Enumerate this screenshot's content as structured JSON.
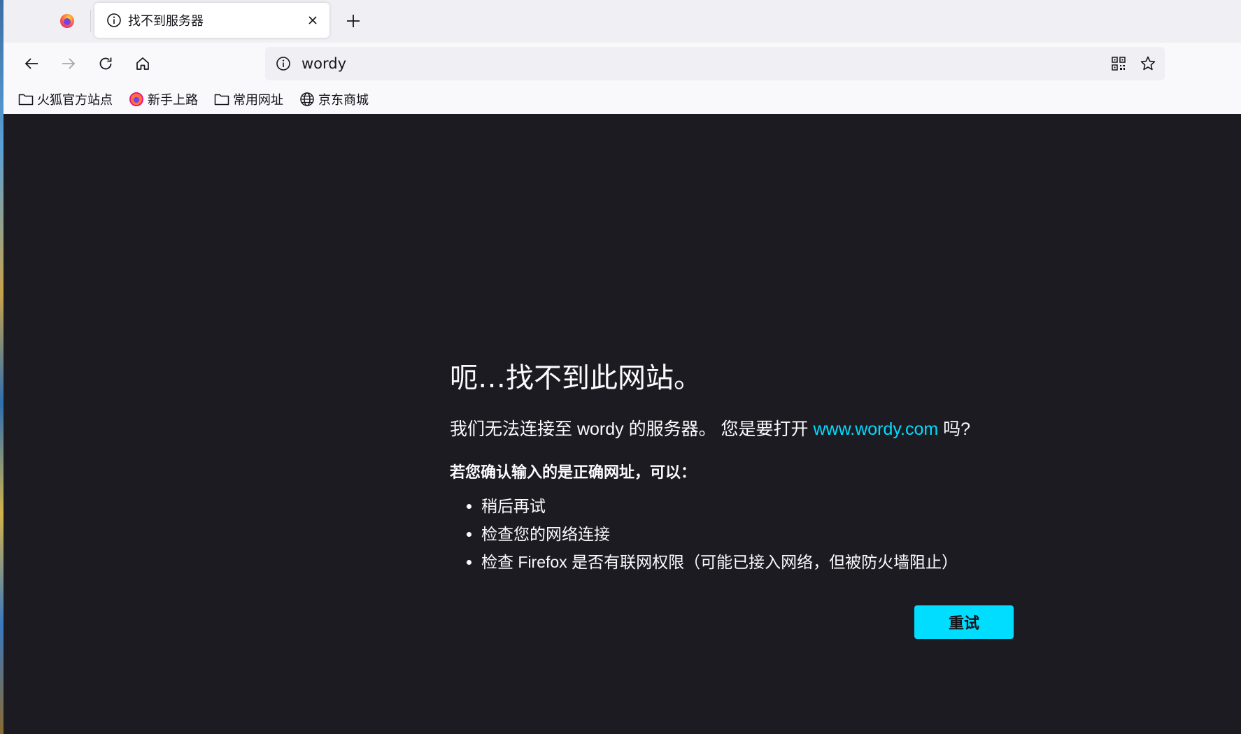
{
  "tabs": {
    "active_title": "找不到服务器"
  },
  "urlbar": {
    "value": "wordy"
  },
  "bookmarks": [
    {
      "label": "火狐官方站点",
      "icon": "folder-icon"
    },
    {
      "label": "新手上路",
      "icon": "firefox-icon"
    },
    {
      "label": "常用网址",
      "icon": "folder-icon"
    },
    {
      "label": "京东商城",
      "icon": "globe-icon"
    }
  ],
  "error": {
    "title": "呃…找不到此网站。",
    "desc_prefix": "我们无法连接至 wordy 的服务器。 您是要打开 ",
    "suggested_link": "www.wordy.com",
    "desc_suffix": " 吗?",
    "subheading": "若您确认输入的是正确网址，可以：",
    "suggestions": [
      "稍后再试",
      "检查您的网络连接",
      "检查 Firefox 是否有联网权限（可能已接入网络，但被防火墙阻止）"
    ],
    "retry_label": "重试"
  },
  "colors": {
    "page_bg": "#1c1b22",
    "link": "#00ddff",
    "button": "#00ddff",
    "text": "#fbfbfe"
  }
}
